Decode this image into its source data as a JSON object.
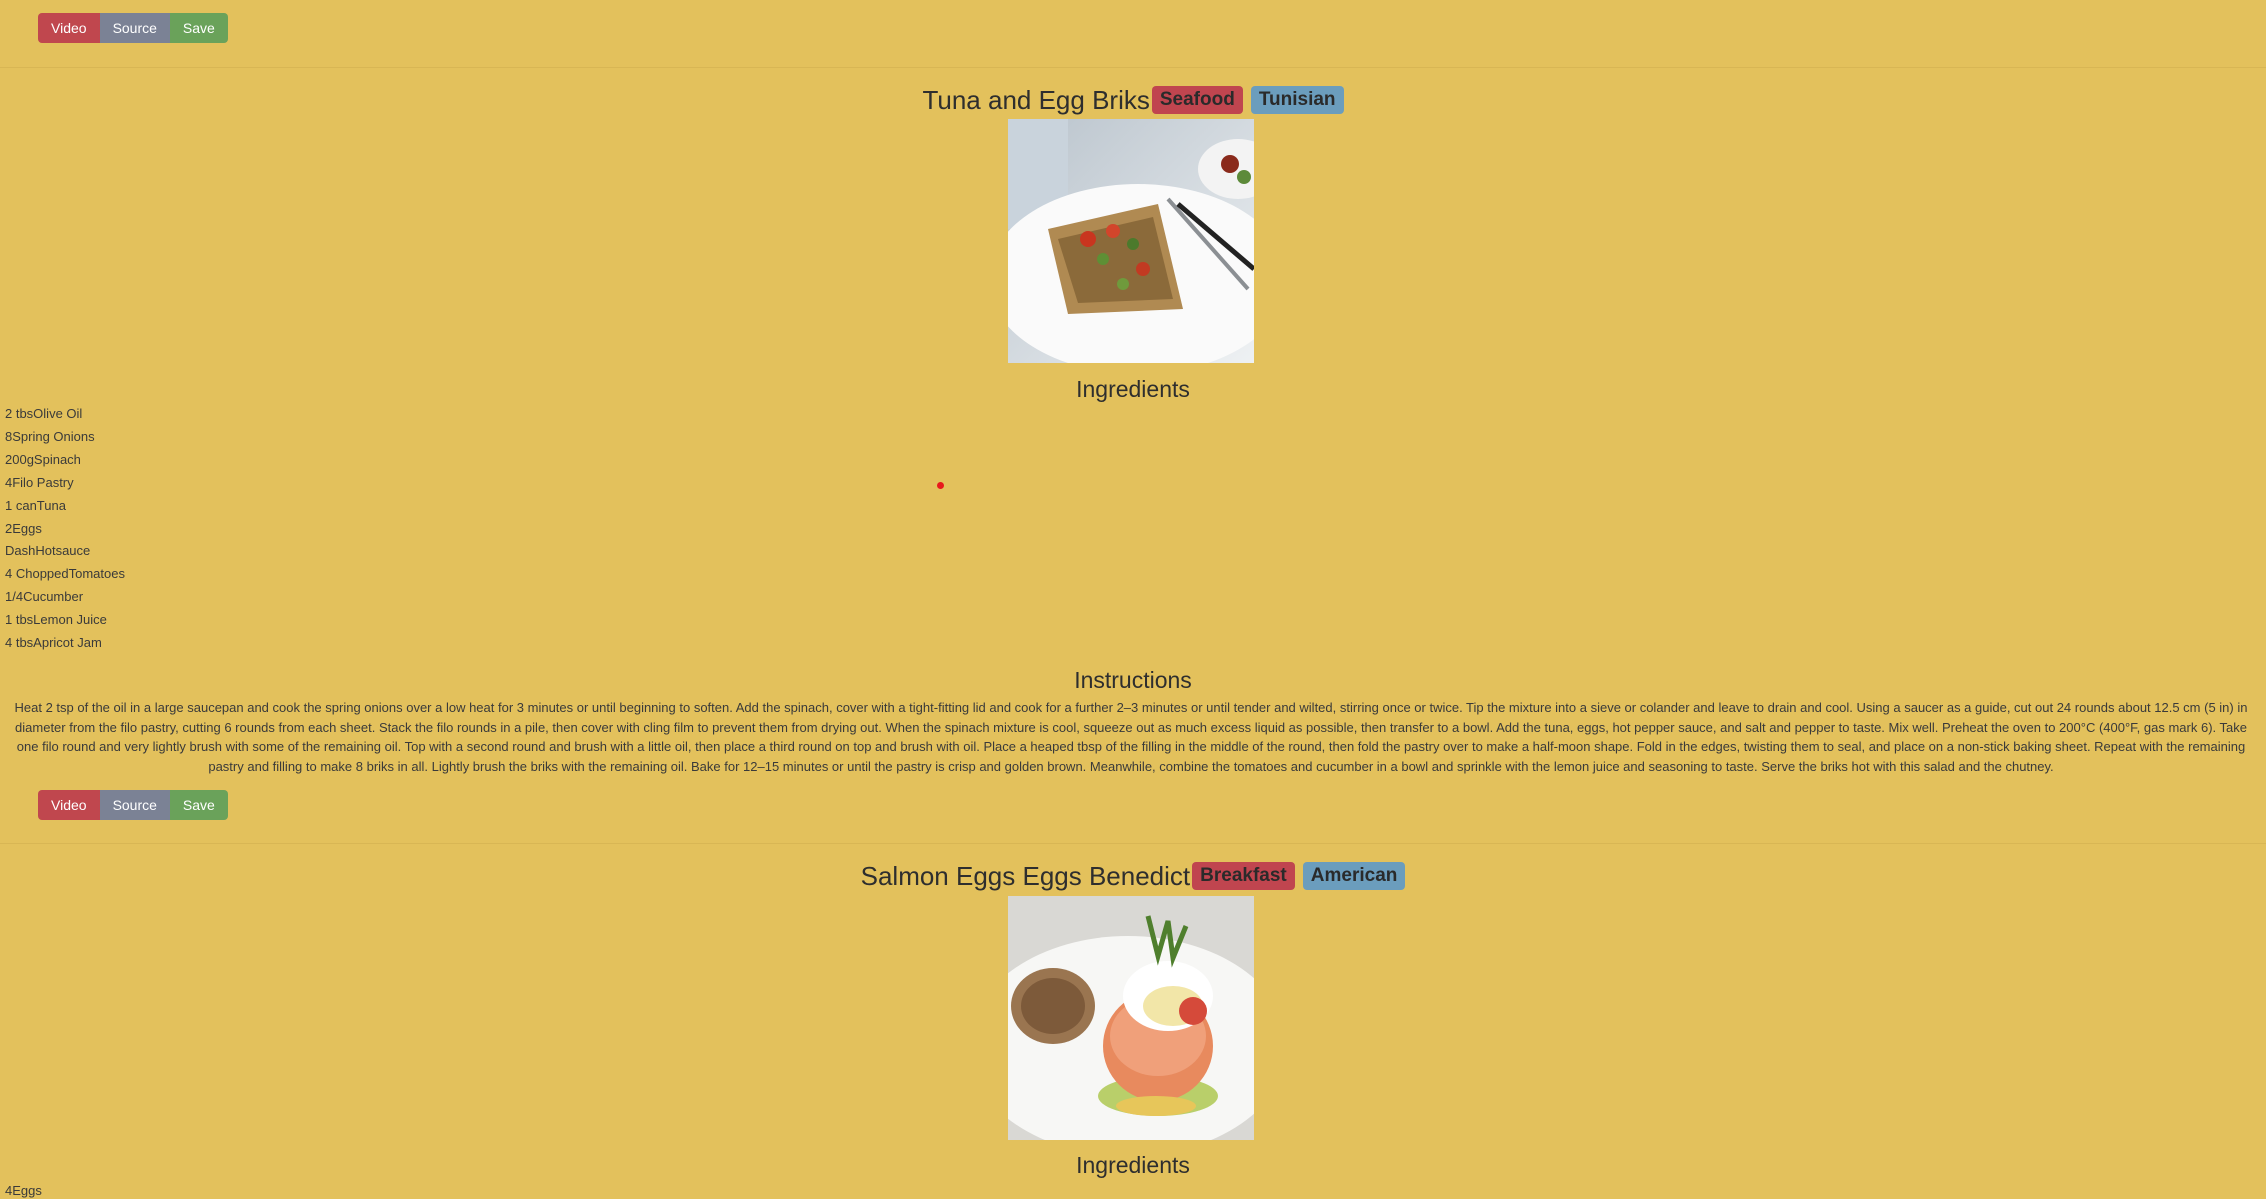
{
  "buttons": {
    "video": "Video",
    "source": "Source",
    "save": "Save"
  },
  "recipes": [
    {
      "title": "Tuna and Egg Briks",
      "category": "Seafood",
      "area": "Tunisian",
      "ingredients_heading": "Ingredients",
      "ingredients": [
        "2 tbsOlive Oil",
        "8Spring Onions",
        "200gSpinach",
        "4Filo Pastry",
        "1 canTuna",
        "2Eggs",
        "DashHotsauce",
        "4 ChoppedTomatoes",
        "1/4Cucumber",
        "1 tbsLemon Juice",
        "4 tbsApricot Jam"
      ],
      "instructions_heading": "Instructions",
      "instructions": "Heat 2 tsp of the oil in a large saucepan and cook the spring onions over a low heat for 3 minutes or until beginning to soften. Add the spinach, cover with a tight-fitting lid and cook for a further 2–3 minutes or until tender and wilted, stirring once or twice. Tip the mixture into a sieve or colander and leave to drain and cool. Using a saucer as a guide, cut out 24 rounds about 12.5 cm (5 in) in diameter from the filo pastry, cutting 6 rounds from each sheet. Stack the filo rounds in a pile, then cover with cling film to prevent them from drying out. When the spinach mixture is cool, squeeze out as much excess liquid as possible, then transfer to a bowl. Add the tuna, eggs, hot pepper sauce, and salt and pepper to taste. Mix well. Preheat the oven to 200°C (400°F, gas mark 6). Take one filo round and very lightly brush with some of the remaining oil. Top with a second round and brush with a little oil, then place a third round on top and brush with oil. Place a heaped tbsp of the filling in the middle of the round, then fold the pastry over to make a half-moon shape. Fold in the edges, twisting them to seal, and place on a non-stick baking sheet. Repeat with the remaining pastry and filling to make 8 briks in all. Lightly brush the briks with the remaining oil. Bake for 12–15 minutes or until the pastry is crisp and golden brown. Meanwhile, combine the tomatoes and cucumber in a bowl and sprinkle with the lemon juice and seasoning to taste. Serve the briks hot with this salad and the chutney."
    },
    {
      "title": "Salmon Eggs Eggs Benedict",
      "category": "Breakfast",
      "area": "American",
      "ingredients_heading": "Ingredients",
      "ingredients": [
        "4Eggs"
      ]
    }
  ],
  "colors": {
    "background": "#e3c15c",
    "video_button": "#c0474e",
    "source_button": "#7b8295",
    "save_button": "#6aa25a",
    "category_badge": "#c0454f",
    "area_badge": "#6b9dbd",
    "cursor_dot": "#e8191c"
  }
}
